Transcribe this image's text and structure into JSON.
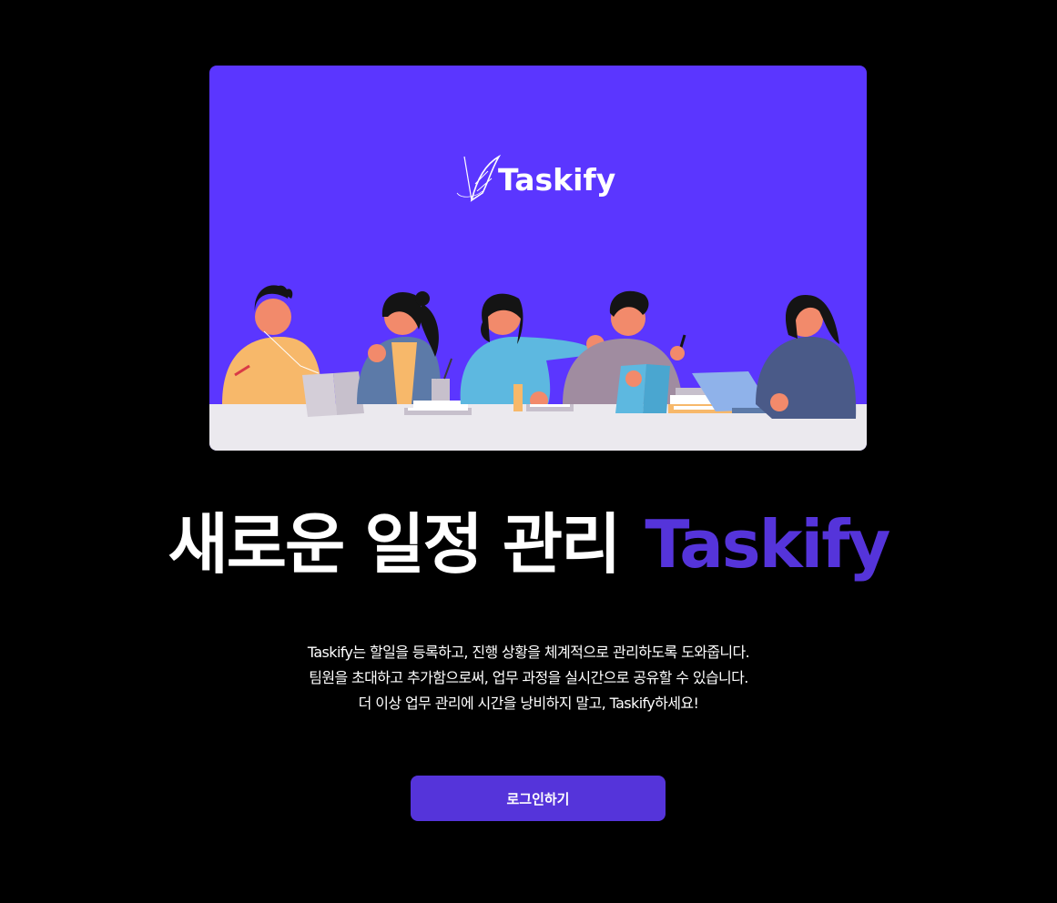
{
  "hero": {
    "logo_text": "Taskify",
    "logo_icon": "feather-quill-icon",
    "illustration": "team-collaboration-illustration",
    "background_color": "#5b36ff",
    "table_color": "#ebe9ee"
  },
  "headline": {
    "main": "새로운 일정 관리",
    "brand": "Taskify",
    "accent_color": "#5534da"
  },
  "description": {
    "lines": [
      "Taskify는 할일을 등록하고, 진행 상황을 체계적으로 관리하도록 도와줍니다.",
      "팀원을 초대하고 추가함으로써, 업무 과정을 실시간으로 공유할 수 있습니다.",
      "더 이상 업무 관리에 시간을 낭비하지 말고, Taskify하세요!"
    ]
  },
  "login_button": {
    "label": "로그인하기",
    "color": "#5534da"
  }
}
